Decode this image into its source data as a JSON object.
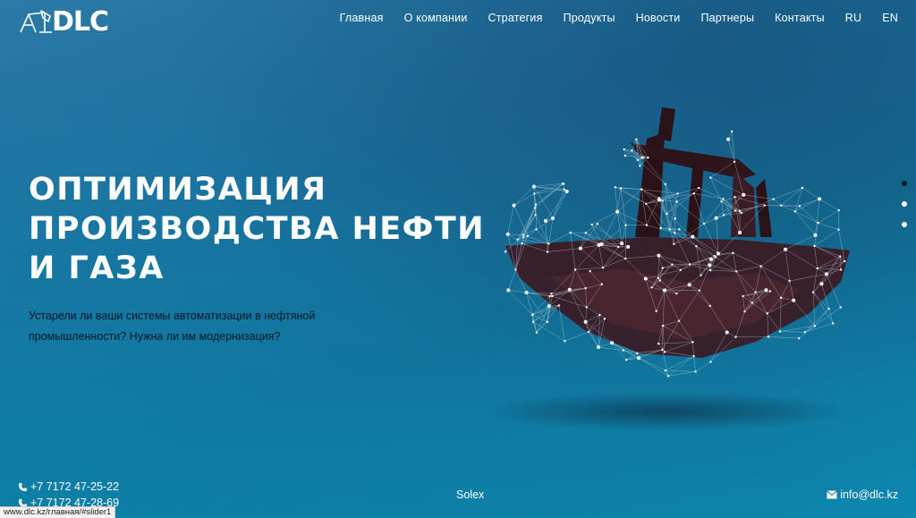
{
  "header": {
    "logo_text": "DLC",
    "nav": [
      "Главная",
      "О компании",
      "Стратегия",
      "Продукты",
      "Новости",
      "Партнеры",
      "Контакты",
      "RU",
      "EN"
    ]
  },
  "hero": {
    "title_lines": [
      "ОПТИМИЗАЦИЯ",
      "ПРОИЗВОДСТВА НЕФТИ",
      "И ГАЗА"
    ],
    "subtitle": "Устарели ли ваши системы автоматизации в нефтяной промышленности? Нужна ли им модернизация?"
  },
  "slider": {
    "count": 3,
    "active": 0
  },
  "footer": {
    "phones": [
      "+7 7172 47-25-22",
      "+7 7172 47-28-69"
    ],
    "center_text": "Solex",
    "email": "info@dlc.kz"
  },
  "status_bar": {
    "url": "www.dlc.kz/главная/#slider1"
  },
  "icons": {
    "logo": "oil-pump-logo-icon",
    "phone": "phone-icon",
    "email": "envelope-icon",
    "illustration": "oil-pump-network-illustration"
  },
  "colors": {
    "background_top": "#2b79a6",
    "background_bottom": "#0c87b0",
    "subtitle_text": "#0a1628",
    "active_dot": "#0b1422"
  }
}
